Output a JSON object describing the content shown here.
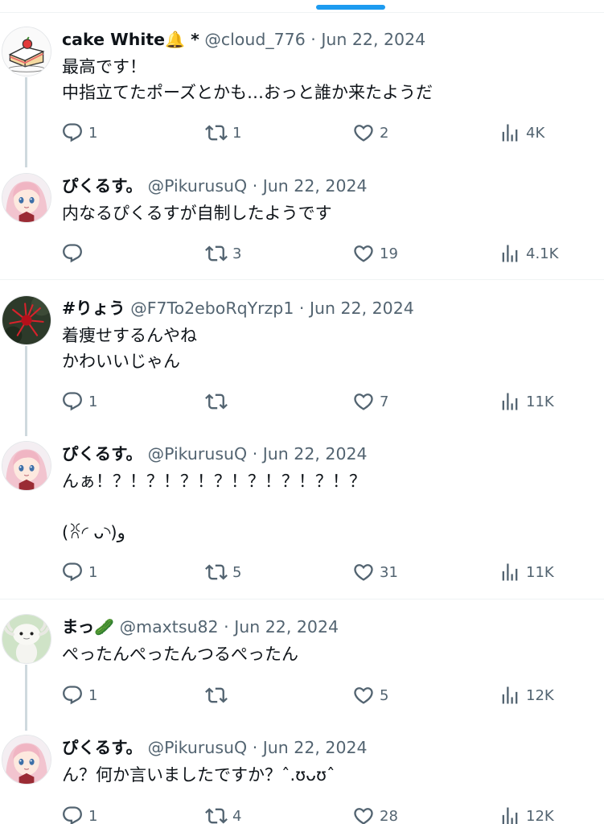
{
  "tweets": [
    {
      "name": "cake White",
      "name_emoji": "🔔",
      "name_suffix": " *",
      "handle": "@cloud_776",
      "separator": "·",
      "date": "Jun 22, 2024",
      "lines": [
        "最高です！",
        "中指立てたポーズとかも…おっと誰か来たようだ"
      ],
      "avatar_icon": "cake-icon",
      "stats": {
        "replies": "1",
        "retweets": "1",
        "likes": "2",
        "views": "4K"
      }
    },
    {
      "name": "ぴくるす。",
      "handle": "@PikurusuQ",
      "separator": "·",
      "date": "Jun 22, 2024",
      "lines": [
        "内なるぴくるすが自制したようです"
      ],
      "avatar_icon": "anime-girl-avatar",
      "stats": {
        "replies": "",
        "retweets": "3",
        "likes": "19",
        "views": "4.1K"
      }
    },
    {
      "name": "#りょう",
      "handle": "@F7To2eboRqYrzp1",
      "separator": "·",
      "date": "Jun 22, 2024",
      "lines": [
        "着痩せするんやね",
        "かわいいじゃん"
      ],
      "avatar_icon": "red-flower-avatar",
      "stats": {
        "replies": "1",
        "retweets": "",
        "likes": "7",
        "views": "11K"
      }
    },
    {
      "name": "ぴくるす。",
      "handle": "@PikurusuQ",
      "separator": "·",
      "date": "Jun 22, 2024",
      "lines": [
        "んぁ！？！？！？！？！？！？！？！？",
        "",
        "(ꐦ◜ ᴗ◝)و"
      ],
      "avatar_icon": "anime-girl-avatar",
      "stats": {
        "replies": "1",
        "retweets": "5",
        "likes": "31",
        "views": "11K"
      }
    },
    {
      "name": "まっ",
      "name_emoji": "🥒",
      "handle": "@maxtsu82",
      "separator": "·",
      "date": "Jun 22, 2024",
      "lines": [
        "ぺったんぺったんつるぺったん"
      ],
      "avatar_icon": "axolotl-avatar",
      "stats": {
        "replies": "1",
        "retweets": "",
        "likes": "5",
        "views": "12K"
      }
    },
    {
      "name": "ぴくるす。",
      "handle": "@PikurusuQ",
      "separator": "·",
      "date": "Jun 22, 2024",
      "lines": [
        "ん？何か言いましたですか？ˆ.ʊᴗʊˆ"
      ],
      "avatar_icon": "anime-girl-avatar",
      "stats": {
        "replies": "1",
        "retweets": "4",
        "likes": "28",
        "views": "12K"
      }
    }
  ],
  "icons": {
    "reply": "reply-icon",
    "retweet": "retweet-icon",
    "like": "like-icon",
    "views": "views-icon"
  },
  "colors": {
    "accent": "#1d9bf0",
    "muted_text": "#536471",
    "thread_line": "#cfd9de",
    "divider": "#eff3f4"
  }
}
